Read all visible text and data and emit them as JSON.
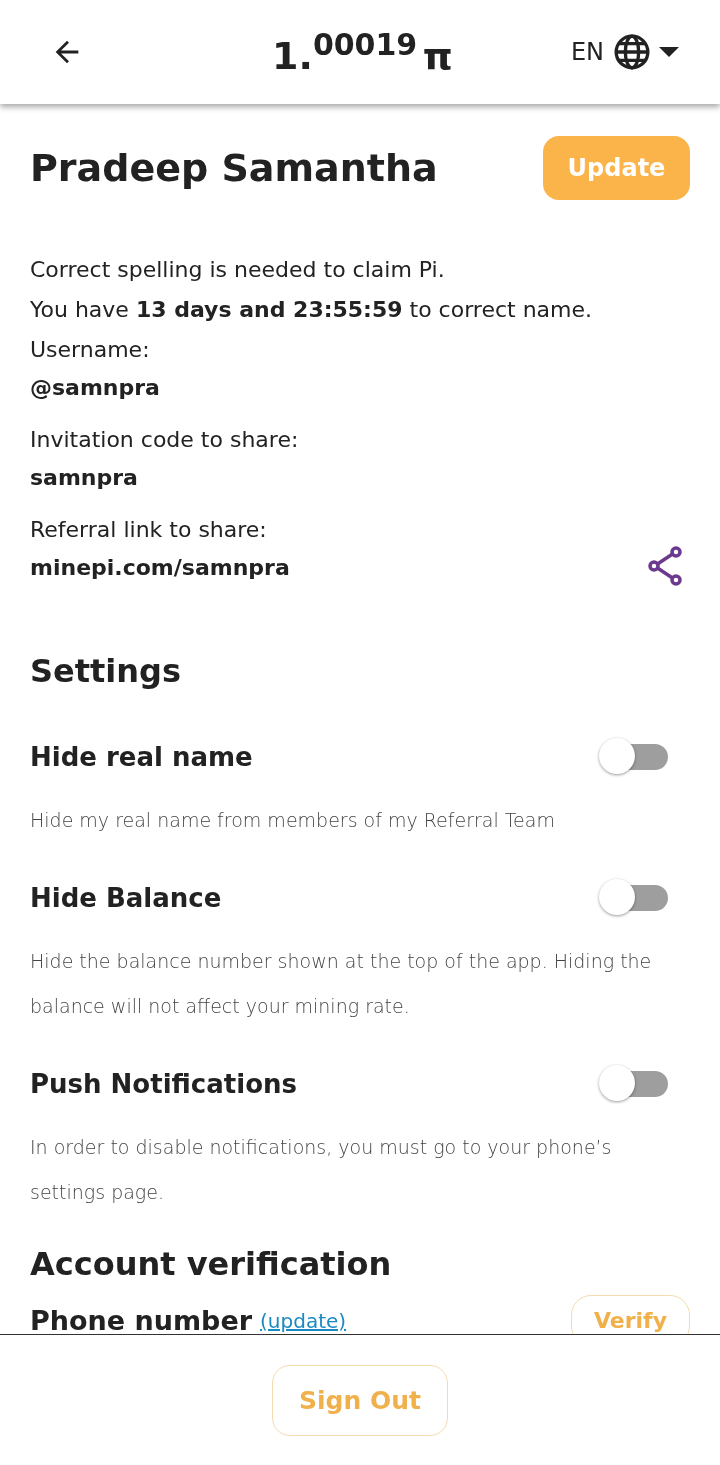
{
  "header": {
    "balance_whole": "1.",
    "balance_fraction": "00019",
    "currency_symbol": "π",
    "language": "EN"
  },
  "profile": {
    "name": "Pradeep Samantha",
    "update_button": "Update",
    "notice": [
      "Correct spelling is needed to claim Pi.",
      "You have **13 days and 23:55:59** to correct name."
    ],
    "fields": [
      {
        "label": "Username:",
        "value": "@samnpra",
        "shareable": false
      },
      {
        "label": "Invitation code to share:",
        "value": "samnpra",
        "shareable": false
      },
      {
        "label": "Referral link to share:",
        "value": "minepi.com/samnpra",
        "shareable": true
      }
    ]
  },
  "settings": {
    "title": "Settings",
    "items": [
      {
        "label": "Hide real name",
        "description": "Hide my real name from members of my Referral Team",
        "on": false
      },
      {
        "label": "Hide Balance",
        "description": "Hide the balance number shown at the top of the app. Hiding the balance will not affect your mining rate.",
        "on": false
      },
      {
        "label": "Push Notifications",
        "description": "In order to disable notifications, you must go to your phone’s settings page.",
        "on": false
      }
    ]
  },
  "verification": {
    "title": "Account verification",
    "phone_label": "Phone number",
    "update_link": "(update)",
    "verify_button": "Verify"
  },
  "footer": {
    "sign_out_button": "Sign Out"
  }
}
